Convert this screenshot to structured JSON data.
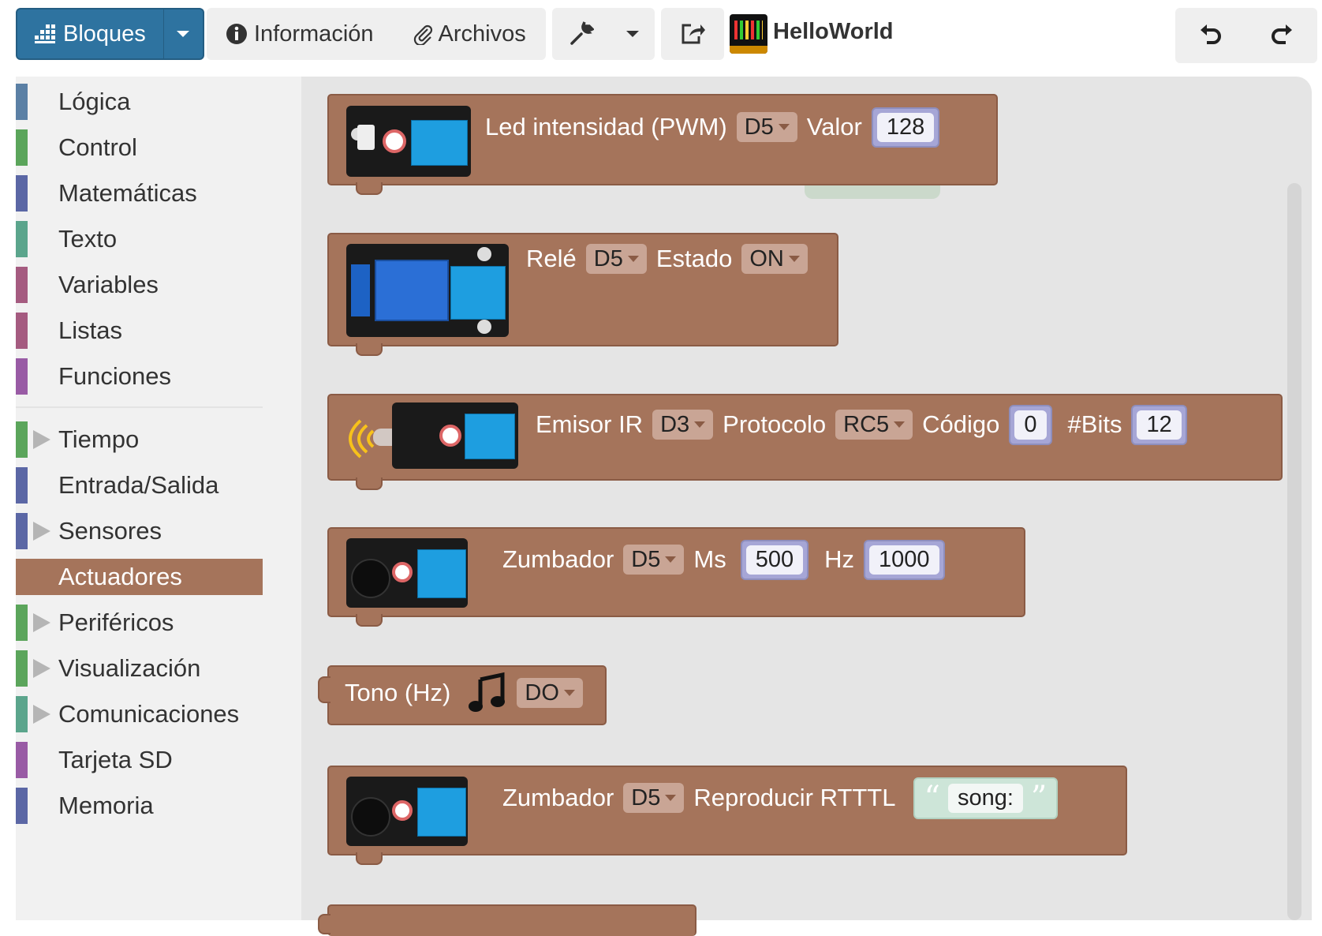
{
  "toolbar": {
    "bloques": "Bloques",
    "informacion": "Información",
    "archivos": "Archivos",
    "project_name": "HelloWorld"
  },
  "sidebar": {
    "categories": [
      {
        "label": "Lógica",
        "color": "#5b80a5",
        "expandable": false
      },
      {
        "label": "Control",
        "color": "#5ba55b",
        "expandable": false
      },
      {
        "label": "Matemáticas",
        "color": "#5b67a5",
        "expandable": false
      },
      {
        "label": "Texto",
        "color": "#5ba58c",
        "expandable": false
      },
      {
        "label": "Variables",
        "color": "#a55b80",
        "expandable": false
      },
      {
        "label": "Listas",
        "color": "#a55b80",
        "expandable": false
      },
      {
        "label": "Funciones",
        "color": "#995ba5",
        "expandable": false
      },
      {
        "label": "Tiempo",
        "color": "#5ba55b",
        "expandable": true
      },
      {
        "label": "Entrada/Salida",
        "color": "#5b67a5",
        "expandable": false
      },
      {
        "label": "Sensores",
        "color": "#5b67a5",
        "expandable": true
      },
      {
        "label": "Actuadores",
        "color": "#a5745b",
        "expandable": false,
        "selected": true
      },
      {
        "label": "Periféricos",
        "color": "#5ba55b",
        "expandable": true
      },
      {
        "label": "Visualización",
        "color": "#5ba55b",
        "expandable": true
      },
      {
        "label": "Comunicaciones",
        "color": "#5ba58c",
        "expandable": true
      },
      {
        "label": "Tarjeta SD",
        "color": "#995ba5",
        "expandable": false
      },
      {
        "label": "Memoria",
        "color": "#5b67a5",
        "expandable": false
      }
    ]
  },
  "blocks": {
    "led": {
      "title": "Led intensidad (PWM)",
      "pin": "D5",
      "valor_label": "Valor",
      "valor": "128"
    },
    "rele": {
      "title": "Relé",
      "pin": "D5",
      "estado_label": "Estado",
      "estado": "ON"
    },
    "ir": {
      "title": "Emisor IR",
      "pin": "D3",
      "protocolo_label": "Protocolo",
      "protocolo": "RC5",
      "codigo_label": "Código",
      "codigo": "0",
      "bits_label": "#Bits",
      "bits": "12"
    },
    "zumbador": {
      "title": "Zumbador",
      "pin": "D5",
      "ms_label": "Ms",
      "ms": "500",
      "hz_label": "Hz",
      "hz": "1000"
    },
    "tono": {
      "title": "Tono (Hz)",
      "nota": "DO"
    },
    "rtttl": {
      "title": "Zumbador",
      "pin": "D5",
      "accion": "Reproducir RTTTL",
      "texto": "song:"
    }
  },
  "colors": {
    "actuadores": "#a5745b",
    "bloques_button": "#2e73a0"
  }
}
